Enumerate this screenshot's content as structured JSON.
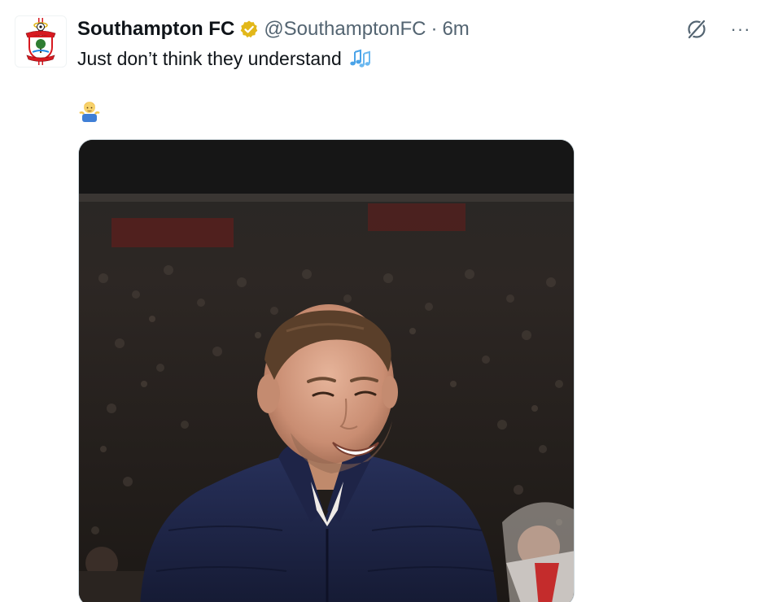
{
  "tweet": {
    "display_name": "Southampton FC",
    "handle": "@SouthamptonFC",
    "separator": "·",
    "timestamp": "6m",
    "text": "Just don’t think they understand",
    "emojis": [
      "musical-notes",
      "man-shrugging"
    ],
    "verified_badge": "gold-checkmark"
  },
  "actions": {
    "grok_icon": "grok-icon",
    "more_label": "···"
  },
  "colors": {
    "text_primary": "#0f1419",
    "text_secondary": "#536471",
    "verified_gold": "#e2b719",
    "jacket_navy": "#1d2240"
  },
  "media": {
    "type": "photo",
    "subject": "smiling-man-navy-jacket-stadium"
  }
}
